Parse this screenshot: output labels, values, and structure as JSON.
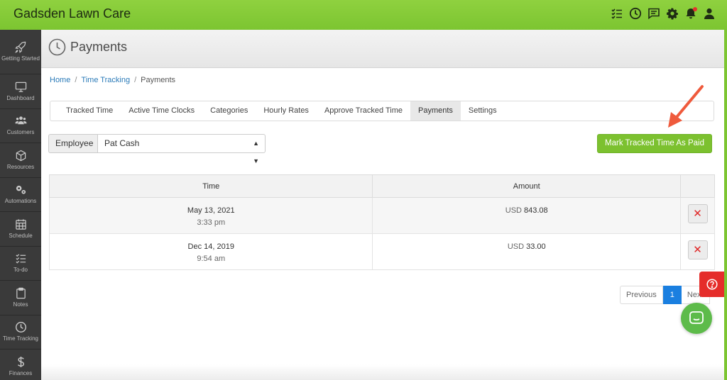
{
  "app": {
    "title": "Gadsden Lawn Care"
  },
  "top_icons": [
    "checklist-icon",
    "clock-icon",
    "chat-icon",
    "gear-icon",
    "bell-icon",
    "user-icon"
  ],
  "sidebar": {
    "items": [
      {
        "label": "Getting Started",
        "icon": "rocket-icon"
      },
      {
        "label": "Dashboard",
        "icon": "monitor-icon"
      },
      {
        "label": "Customers",
        "icon": "users-icon"
      },
      {
        "label": "Resources",
        "icon": "cube-icon"
      },
      {
        "label": "Automations",
        "icon": "cogs-icon"
      },
      {
        "label": "Schedule",
        "icon": "calendar-icon"
      },
      {
        "label": "To-do",
        "icon": "checklist-icon"
      },
      {
        "label": "Notes",
        "icon": "clipboard-icon"
      },
      {
        "label": "Time Tracking",
        "icon": "clock-icon"
      },
      {
        "label": "Finances",
        "icon": "dollar-icon"
      }
    ]
  },
  "page": {
    "title": "Payments"
  },
  "breadcrumb": {
    "home": "Home",
    "section": "Time Tracking",
    "current": "Payments",
    "sep": "/"
  },
  "tabs": [
    {
      "label": "Tracked Time"
    },
    {
      "label": "Active Time Clocks"
    },
    {
      "label": "Categories"
    },
    {
      "label": "Hourly Rates"
    },
    {
      "label": "Approve Tracked Time"
    },
    {
      "label": "Payments",
      "active": true
    },
    {
      "label": "Settings"
    }
  ],
  "filter": {
    "label": "Employee",
    "selected": "Pat Cash"
  },
  "actions": {
    "mark_paid": "Mark Tracked Time As Paid"
  },
  "table": {
    "headers": {
      "time": "Time",
      "amount": "Amount"
    },
    "rows": [
      {
        "date": "May 13, 2021",
        "time": "3:33 pm",
        "currency": "USD",
        "amount": "843.08"
      },
      {
        "date": "Dec 14, 2019",
        "time": "9:54 am",
        "currency": "USD",
        "amount": "33.00"
      }
    ]
  },
  "pagination": {
    "previous": "Previous",
    "current": "1",
    "next": "Next"
  },
  "colors": {
    "brand_green": "#7cc531",
    "button_green": "#7cc12f",
    "sidebar": "#3a3a3a",
    "danger": "#e02828",
    "page_blue": "#1a7fe0",
    "arrow": "#ef5a3c"
  }
}
